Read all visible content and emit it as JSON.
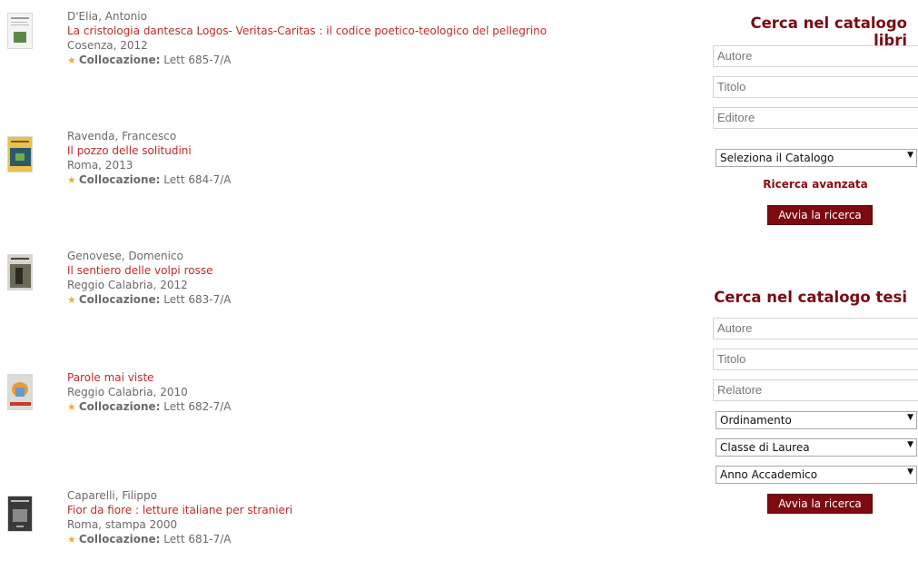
{
  "books": [
    {
      "author": "D'Elia, Antonio",
      "title": "La cristologia dantesca Logos- Veritas-Caritas : il codice poetico-teologico del pellegrino",
      "place": "Cosenza, 2012",
      "loc_label": "Collocazione:",
      "loc_value": "Lett 685-7/A"
    },
    {
      "author": "Ravenda, Francesco",
      "title": "Il pozzo delle solitudini",
      "place": "Roma, 2013",
      "loc_label": "Collocazione:",
      "loc_value": "Lett 684-7/A"
    },
    {
      "author": "Genovese, Domenico",
      "title": "Il sentiero delle volpi rosse",
      "place": "Reggio Calabria, 2012",
      "loc_label": "Collocazione:",
      "loc_value": "Lett 683-7/A"
    },
    {
      "author": "",
      "title": "Parole mai viste",
      "place": "Reggio Calabria, 2010",
      "loc_label": "Collocazione:",
      "loc_value": "Lett 682-7/A"
    },
    {
      "author": "Caparelli, Filippo",
      "title": "Fior da fiore : letture italiane per stranieri",
      "place": "Roma, stampa 2000",
      "loc_label": "Collocazione:",
      "loc_value": "Lett 681-7/A"
    }
  ],
  "search_books": {
    "heading": "Cerca nel catalogo libri",
    "author_placeholder": "Autore",
    "title_placeholder": "Titolo",
    "publisher_placeholder": "Editore",
    "catalog_select": "Seleziona il Catalogo",
    "advanced": "Ricerca avanzata",
    "button": "Avvia la ricerca"
  },
  "search_theses": {
    "heading": "Cerca nel catalogo tesi",
    "author_placeholder": "Autore",
    "title_placeholder": "Titolo",
    "supervisor_placeholder": "Relatore",
    "sort_select": "Ordinamento",
    "degree_select": "Classe di Laurea",
    "year_select": "Anno Accademico",
    "button": "Avvia la ricerca"
  },
  "colors": {
    "title_red": "#c22a2a",
    "heading_maroon": "#7a0b12",
    "button_bg": "#7c0a10",
    "star": "#e8b23a"
  }
}
